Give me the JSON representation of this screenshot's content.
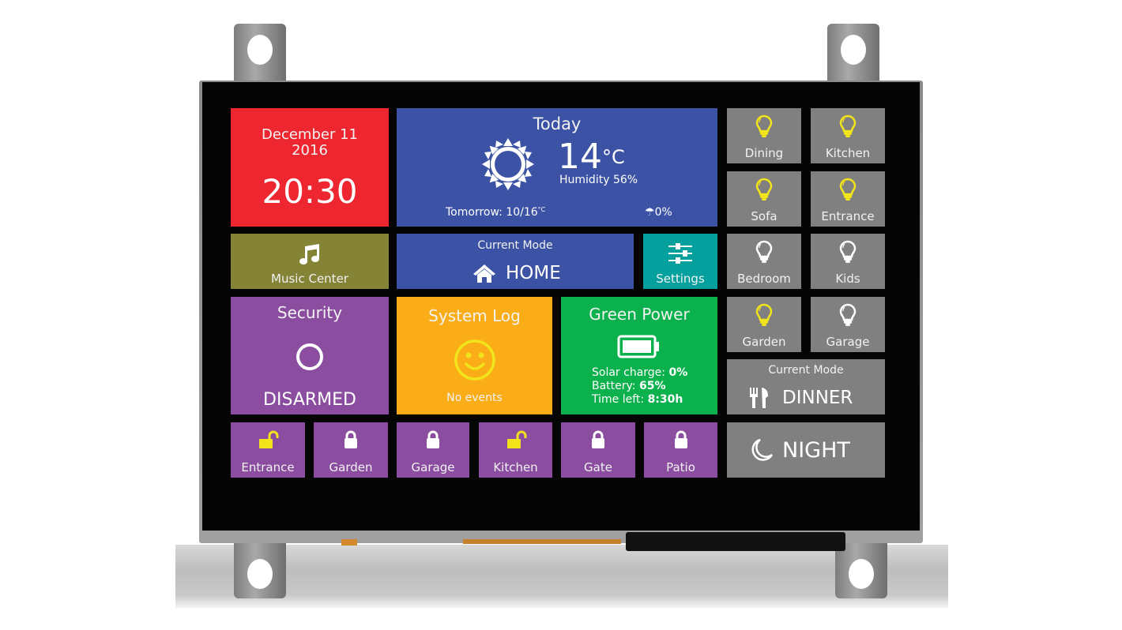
{
  "datetime": {
    "date_line1": "December 11",
    "date_line2": "2016",
    "time": "20:30"
  },
  "weather": {
    "title": "Today",
    "temperature": "14",
    "temp_unit": "°C",
    "humidity_label": "Humidity",
    "humidity_value": "56%",
    "tomorrow_label": "Tomorrow: 10/16",
    "tomorrow_unit": "°C",
    "rain_chance": "0%"
  },
  "lights": [
    {
      "label": "Dining",
      "state": "on"
    },
    {
      "label": "Kitchen",
      "state": "on"
    },
    {
      "label": "Sofa",
      "state": "on"
    },
    {
      "label": "Entrance",
      "state": "on"
    },
    {
      "label": "Bedroom",
      "state": "off"
    },
    {
      "label": "Kids",
      "state": "off"
    },
    {
      "label": "Garden",
      "state": "on"
    },
    {
      "label": "Garage",
      "state": "off"
    }
  ],
  "music": {
    "label": "Music Center"
  },
  "home_mode": {
    "caption": "Current Mode",
    "value": "HOME"
  },
  "settings": {
    "label": "Settings"
  },
  "security": {
    "title": "Security",
    "status": "DISARMED"
  },
  "system_log": {
    "title": "System Log",
    "status": "No events"
  },
  "green_power": {
    "title": "Green Power",
    "solar_label": "Solar charge:",
    "solar_value": "0%",
    "battery_label": "Battery:",
    "battery_value": "65%",
    "time_label": "Time left:",
    "time_value": "8:30h",
    "battery_level": 0.65
  },
  "locks": [
    {
      "label": "Entrance",
      "state": "unlocked"
    },
    {
      "label": "Garden",
      "state": "locked"
    },
    {
      "label": "Garage",
      "state": "locked"
    },
    {
      "label": "Kitchen",
      "state": "unlocked"
    },
    {
      "label": "Gate",
      "state": "locked"
    },
    {
      "label": "Patio",
      "state": "locked"
    }
  ],
  "dinner_mode": {
    "caption": "Current Mode",
    "value": "DINNER"
  },
  "night_mode": {
    "value": "NIGHT"
  },
  "colors": {
    "light_on": "#f2e41b",
    "light_off": "#ffffff",
    "lock_unlocked": "#f2e41b",
    "lock_locked": "#ffffff"
  }
}
